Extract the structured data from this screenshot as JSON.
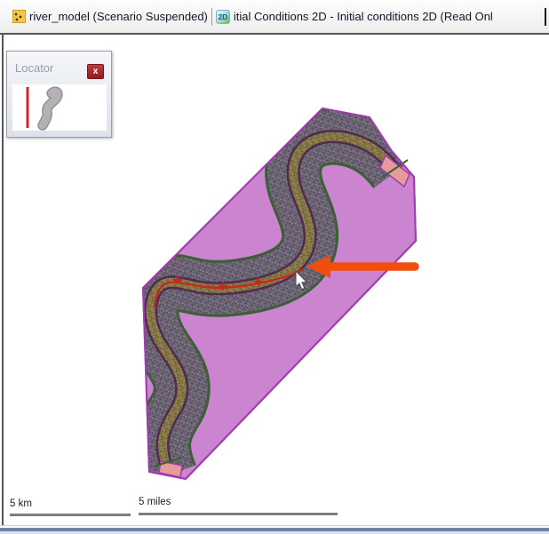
{
  "tab_bar": {
    "tabs": [
      {
        "label": "river_model (Scenario Suspended)"
      },
      {
        "label": "itial Conditions 2D - Initial conditions 2D (Read Onl",
        "icon_text": "2D"
      }
    ]
  },
  "locator": {
    "title": "Locator",
    "close": "x"
  },
  "map": {
    "scale_km": "5 km",
    "scale_miles": "5 miles",
    "annotation": "orange arrow pointing left at river channel"
  },
  "colors": {
    "flow_area_fill": "#ca84d0",
    "flow_area_border": "#a23bb0",
    "floodplain_fill": "#6b6372",
    "floodplain_border": "#3c5f35",
    "channel_fill": "#857748",
    "channel_border": "#512b4d",
    "boundary_gate_fill": "#e59b9b",
    "centerline_red": "#c22b20",
    "arrow_orange": "#f04e11",
    "locator_close_red": "#a8252b"
  }
}
